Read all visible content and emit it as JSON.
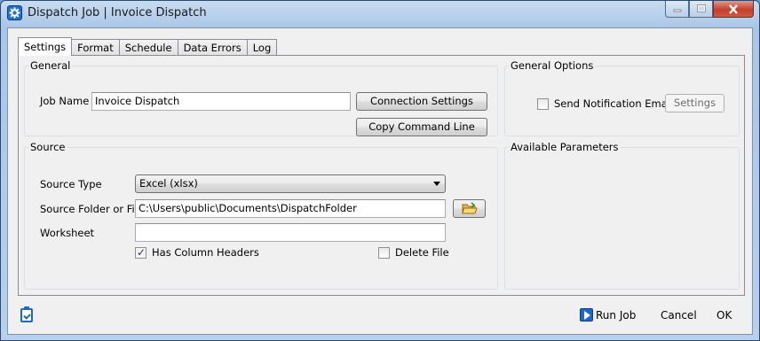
{
  "window": {
    "title": "Dispatch Job | Invoice Dispatch"
  },
  "tabs": [
    "Settings",
    "Format",
    "Schedule",
    "Data Errors",
    "Log"
  ],
  "general": {
    "legend": "General",
    "job_name_label": "Job Name",
    "job_name_value": "Invoice Dispatch",
    "connection_settings_label": "Connection Settings",
    "copy_command_line_label": "Copy Command Line"
  },
  "general_options": {
    "legend": "General Options",
    "send_notification_label": "Send Notification Email",
    "send_notification_checked": false,
    "settings_label": "Settings"
  },
  "source": {
    "legend": "Source",
    "source_type_label": "Source Type",
    "source_type_value": "Excel (xlsx)",
    "source_folder_label": "Source Folder or File",
    "source_folder_value": "C:\\Users\\public\\Documents\\DispatchFolder",
    "worksheet_label": "Worksheet",
    "worksheet_value": "",
    "has_column_headers_label": "Has Column Headers",
    "has_column_headers_checked": true,
    "delete_file_label": "Delete File",
    "delete_file_checked": false
  },
  "available_parameters": {
    "legend": "Available Parameters"
  },
  "footer": {
    "run_job_label": "Run Job",
    "cancel_label": "Cancel",
    "ok_label": "OK"
  },
  "colors": {
    "accent": "#1d67c9",
    "close_button": "#c2402a"
  }
}
